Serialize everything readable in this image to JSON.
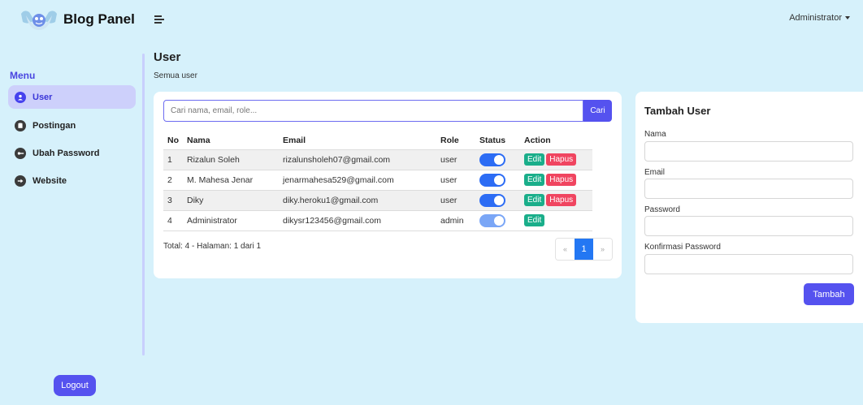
{
  "brand": {
    "title": "Blog Panel"
  },
  "header": {
    "user_menu": "Administrator"
  },
  "sidebar": {
    "title": "Menu",
    "items": [
      {
        "label": "User",
        "icon": "user-icon",
        "active": true
      },
      {
        "label": "Postingan",
        "icon": "database-icon",
        "active": false
      },
      {
        "label": "Ubah Password",
        "icon": "key-icon",
        "active": false
      },
      {
        "label": "Website",
        "icon": "arrow-right-icon",
        "active": false
      }
    ],
    "logout_label": "Logout"
  },
  "page": {
    "title": "User",
    "subtitle": "Semua user"
  },
  "search": {
    "placeholder": "Cari nama, email, role...",
    "button": "Cari"
  },
  "table": {
    "headers": [
      "No",
      "Nama",
      "Email",
      "Role",
      "Status",
      "Action"
    ],
    "rows": [
      {
        "no": "1",
        "nama": "Rizalun Soleh",
        "email": "rizalunsholeh07@gmail.com",
        "role": "user",
        "status": true,
        "edit": "Edit",
        "hapus": "Hapus"
      },
      {
        "no": "2",
        "nama": "M. Mahesa Jenar",
        "email": "jenarmahesa529@gmail.com",
        "role": "user",
        "status": true,
        "edit": "Edit",
        "hapus": "Hapus"
      },
      {
        "no": "3",
        "nama": "Diky",
        "email": "diky.heroku1@gmail.com",
        "role": "user",
        "status": true,
        "edit": "Edit",
        "hapus": "Hapus"
      },
      {
        "no": "4",
        "nama": "Administrator",
        "email": "dikysr123456@gmail.com",
        "role": "admin",
        "status": true,
        "edit": "Edit"
      }
    ],
    "total": "Total: 4 - Halaman: 1 dari 1"
  },
  "pagination": {
    "prev": "«",
    "current": "1",
    "next": "»"
  },
  "form": {
    "title": "Tambah User",
    "fields": [
      {
        "label": "Nama",
        "value": ""
      },
      {
        "label": "Email",
        "value": ""
      },
      {
        "label": "Password",
        "value": ""
      },
      {
        "label": "Konfirmasi Password",
        "value": ""
      }
    ],
    "submit": "Tambah"
  },
  "colors": {
    "accent": "#5552ef",
    "edit": "#1aae8a",
    "hapus": "#f04560",
    "toggle_on": "#2c6cf4",
    "background": "#d6f1fb"
  }
}
